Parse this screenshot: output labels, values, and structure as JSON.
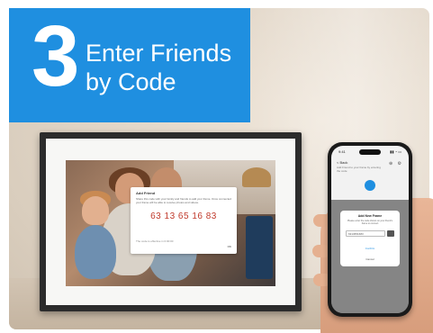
{
  "banner": {
    "step_number": "3",
    "title_line1": "Enter Friends",
    "title_line2": "by Code",
    "background_color": "#1f8fe0"
  },
  "frame_dialog": {
    "title": "Add Friend",
    "description": "Share this code with your family and friends to add your frame. Once connected your frame will be able to receive photos and videos.",
    "code": "63 13 65 16 83",
    "expire_note": "The code is effective in 0:00:00",
    "ok_label": "OK",
    "code_color": "#c0392b"
  },
  "phone": {
    "status_time": "9:41",
    "status_icons": "▮▮ ◔ ▭",
    "header": "< Back",
    "subtitle": "Add Friend to your frame by entering the code",
    "header_icons": "⊕ ⚙",
    "dialog": {
      "title": "Add New Frame",
      "description": "Please enter the code shown on your friend's frame to connect",
      "input_value": "6313651683",
      "confirm_label": "Confirm",
      "cancel_label": "Cancel"
    }
  }
}
